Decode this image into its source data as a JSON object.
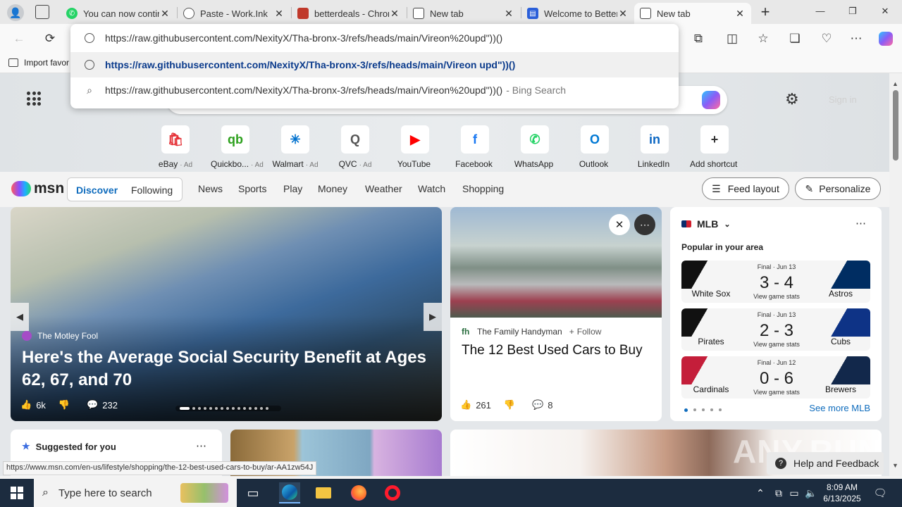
{
  "tabs": [
    {
      "label": "You can now contin",
      "favicon_color": "#25d366",
      "favicon": "whatsapp-icon"
    },
    {
      "label": "Paste - Work.Ink",
      "favicon_color": "#555555",
      "favicon": "globe-icon"
    },
    {
      "label": "betterdeals - Chron",
      "favicon_color": "#c0392b",
      "favicon": "page-icon"
    },
    {
      "label": "New tab",
      "favicon_color": "#444444",
      "favicon": "newtab-icon"
    },
    {
      "label": "Welcome to Better",
      "favicon_color": "#2b5fd9",
      "favicon": "extension-icon"
    },
    {
      "label": "New tab",
      "favicon_color": "#444444",
      "favicon": "newtab-icon"
    }
  ],
  "window_controls": {
    "minimize": "—",
    "restore": "❐",
    "close": "✕"
  },
  "address": {
    "value": "https://raw.githubusercontent.com/NexityX/Tha-bronx-3/refs/heads/main/Vireon%20upd\"))()"
  },
  "omnibox": {
    "suggestion_url": "https://raw.githubusercontent.com/NexityX/Tha-bronx-3/refs/heads/main/Vireon upd\"))()",
    "search_query": "https://raw.githubusercontent.com/NexityX/Tha-bronx-3/refs/heads/main/Vireon%20upd\"))()",
    "search_suffix": "- Bing Search"
  },
  "bookmarks": {
    "import_label": "Import favor"
  },
  "search_area": {
    "signin": "Sign in"
  },
  "shortcuts": [
    {
      "label": "eBay",
      "ad": "· Ad",
      "color": "#e53238",
      "glyph": "🛍"
    },
    {
      "label": "Quickbo...",
      "ad": "· Ad",
      "color": "#2ca01c",
      "glyph": "qb"
    },
    {
      "label": "Walmart",
      "ad": "· Ad",
      "color": "#0071ce",
      "glyph": "✳"
    },
    {
      "label": "QVC",
      "ad": "· Ad",
      "color": "#555555",
      "glyph": "Q"
    },
    {
      "label": "YouTube",
      "ad": "",
      "color": "#ff0000",
      "glyph": "▶"
    },
    {
      "label": "Facebook",
      "ad": "",
      "color": "#1877f2",
      "glyph": "f"
    },
    {
      "label": "WhatsApp",
      "ad": "",
      "color": "#25d366",
      "glyph": "✆"
    },
    {
      "label": "Outlook",
      "ad": "",
      "color": "#0078d4",
      "glyph": "O"
    },
    {
      "label": "LinkedIn",
      "ad": "",
      "color": "#0a66c2",
      "glyph": "in"
    },
    {
      "label": "Add shortcut",
      "ad": "",
      "color": "#333333",
      "glyph": "+"
    }
  ],
  "msn": {
    "logo": "msn",
    "tabs": [
      "Discover",
      "Following"
    ],
    "nav": [
      "News",
      "Sports",
      "Play",
      "Money",
      "Weather",
      "Watch",
      "Shopping"
    ],
    "feed_layout": "Feed layout",
    "personalize": "Personalize"
  },
  "hero_card": {
    "source": "The Motley Fool",
    "headline": "Here's the Average Social Security Benefit at Ages 62, 67, and 70",
    "likes": "6k",
    "comments": "232"
  },
  "article_card": {
    "source": "The Family Handyman",
    "follow": "Follow",
    "headline": "The 12 Best Used Cars to Buy",
    "likes": "261",
    "comments": "8"
  },
  "mlb": {
    "title": "MLB",
    "subtitle": "Popular in your area",
    "see_more": "See more MLB",
    "games": [
      {
        "status": "Final · Jun 13",
        "score": "3 - 4",
        "home": "White Sox",
        "away": "Astros",
        "link": "View game stats",
        "home_color": "#111111",
        "away_color": "#002d62"
      },
      {
        "status": "Final · Jun 13",
        "score": "2 - 3",
        "home": "Pirates",
        "away": "Cubs",
        "link": "View game stats",
        "home_color": "#111111",
        "away_color": "#0e3386"
      },
      {
        "status": "Final · Jun 12",
        "score": "0 - 6",
        "home": "Cardinals",
        "away": "Brewers",
        "link": "View game stats",
        "home_color": "#c41e3a",
        "away_color": "#12284b"
      }
    ]
  },
  "suggested": {
    "title": "Suggested for you"
  },
  "help": {
    "label": "Help and Feedback"
  },
  "watermark": "ANY.RUN",
  "status_url": "https://www.msn.com/en-us/lifestyle/shopping/the-12-best-used-cars-to-buy/ar-AA1zw54J",
  "taskbar": {
    "search_placeholder": "Type here to search",
    "time": "8:09 AM",
    "date": "6/13/2025"
  }
}
